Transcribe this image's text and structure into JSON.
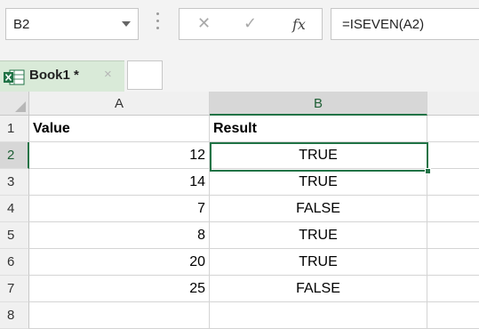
{
  "name_box": {
    "value": "B2"
  },
  "formula_bar": {
    "cancel_glyph": "✕",
    "enter_glyph": "✓",
    "fx_label": "fx",
    "formula": "=ISEVEN(A2)"
  },
  "tabs": [
    {
      "label": "Book1 *",
      "close_glyph": "×"
    }
  ],
  "columns": [
    "A",
    "B"
  ],
  "rows": [
    "1",
    "2",
    "3",
    "4",
    "5",
    "6",
    "7",
    "8"
  ],
  "table": {
    "headers": [
      "Value",
      "Result"
    ],
    "rows": [
      {
        "value": "12",
        "result": "TRUE"
      },
      {
        "value": "14",
        "result": "TRUE"
      },
      {
        "value": "7",
        "result": "FALSE"
      },
      {
        "value": "8",
        "result": "TRUE"
      },
      {
        "value": "20",
        "result": "TRUE"
      },
      {
        "value": "25",
        "result": "FALSE"
      }
    ]
  },
  "selection": {
    "active_cell": "B2"
  },
  "colors": {
    "accent": "#217346",
    "tab_bg": "#d9ead8"
  },
  "icons": {
    "excel_book": "excel-workbook-icon"
  }
}
